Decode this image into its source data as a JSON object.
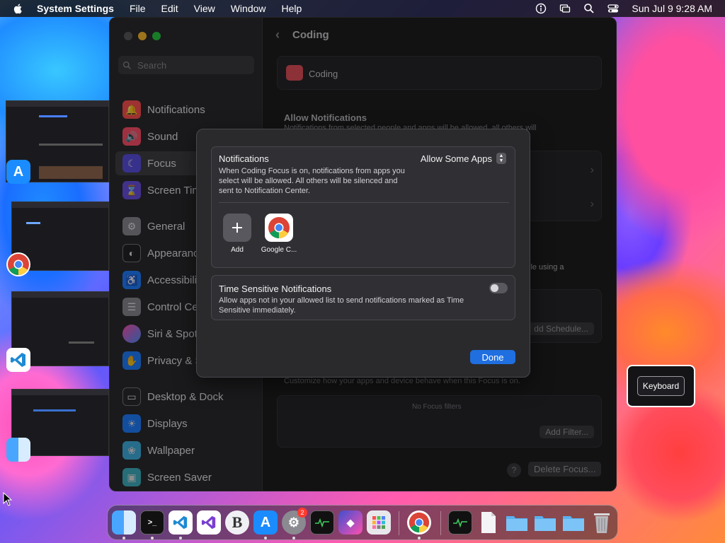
{
  "menubar": {
    "app": "System Settings",
    "menus": [
      "File",
      "Edit",
      "View",
      "Window",
      "Help"
    ],
    "clock": "Sun Jul 9  9:28 AM"
  },
  "settings": {
    "search_placeholder": "Search",
    "sidebar": [
      {
        "label": "Notifications",
        "icon": "bell-icon",
        "color": "#ff4f4f"
      },
      {
        "label": "Sound",
        "icon": "speaker-icon",
        "color": "#ff4f6a"
      },
      {
        "label": "Focus",
        "icon": "moon-icon",
        "color": "#5a4fe0"
      },
      {
        "label": "Screen Tim",
        "icon": "hourglass-icon",
        "color": "#6a4fe0"
      },
      {
        "label": "General",
        "icon": "gear-icon",
        "color": "#8a8a90"
      },
      {
        "label": "Appearanc",
        "icon": "appearance-icon",
        "color": "#222226"
      },
      {
        "label": "Accessibili",
        "icon": "accessibility-icon",
        "color": "#1f7fff"
      },
      {
        "label": "Control Ce",
        "icon": "control-center-icon",
        "color": "#8a8a90"
      },
      {
        "label": "Siri & Spot",
        "icon": "siri-icon",
        "color": "#b04fff"
      },
      {
        "label": "Privacy & S",
        "icon": "hand-icon",
        "color": "#1f7fff"
      },
      {
        "label": "Desktop & Dock",
        "icon": "dock-icon",
        "color": "#2a2a2e"
      },
      {
        "label": "Displays",
        "icon": "sun-icon",
        "color": "#1f7fff"
      },
      {
        "label": "Wallpaper",
        "icon": "wallpaper-icon",
        "color": "#3fb0e0"
      },
      {
        "label": "Screen Saver",
        "icon": "screensaver-icon",
        "color": "#3fb0c0"
      }
    ],
    "main": {
      "back_title": "Coding",
      "focus_name": "Coding",
      "allow_title": "Allow Notifications",
      "allow_desc": "Notifications from selected people and apps will be allowed, all others will",
      "using_text": "ile using a",
      "schedule_btn": "dd Schedule...",
      "filters_desc": "Customize how your apps and device behave when this Focus is on.",
      "no_filters": "No Focus filters",
      "add_filter": "Add Filter...",
      "help": "?",
      "delete_focus": "Delete Focus..."
    }
  },
  "sheet": {
    "notif_title": "Notifications",
    "notif_select": "Allow Some Apps",
    "notif_desc": "When Coding Focus is on, notifications from apps you select will be allowed. All others will be silenced and sent to Notification Center.",
    "apps": [
      {
        "label": "Add",
        "icon": "plus-icon"
      },
      {
        "label": "Google C...",
        "icon": "chrome-icon"
      }
    ],
    "ts_title": "Time Sensitive Notifications",
    "ts_desc": "Allow apps not in your allowed list to send notifications marked as Time Sensitive immediately.",
    "ts_enabled": false,
    "done": "Done"
  },
  "keyboard_hud": "Keyboard",
  "dock": {
    "badge": "2",
    "items": [
      "Finder",
      "Terminal",
      "Visual Studio Code",
      "Visual Studio",
      "BBEdit",
      "App Store",
      "System Settings",
      "Activity Monitor",
      "Shortcuts",
      "Launchpad",
      "Google Chrome",
      "Activity Monitor",
      "Document",
      "Folder",
      "Folder",
      "Folder",
      "Trash"
    ]
  },
  "colors": {
    "accent": "#1f6fe0",
    "window_bg": "#1e1e20"
  }
}
